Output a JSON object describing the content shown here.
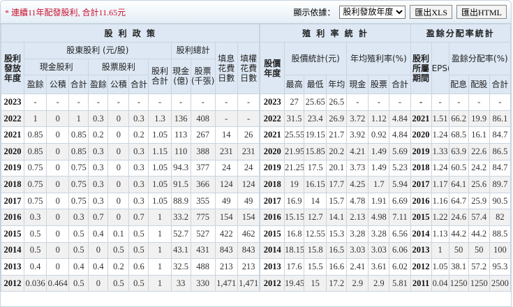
{
  "topbar": {
    "note": "* 連續11年配發股利, 合計11.65元",
    "display_label": "顯示依據：",
    "display_value": "股利發放年度",
    "export_xls": "匯出XLS",
    "export_html": "匯出HTML"
  },
  "header": {
    "policy": "股 利 政 策",
    "yield_stats": "殖 利 率 統 計",
    "payout_stats": "盈餘分配率統計",
    "dist_year": "股利發放年度",
    "shareholder_div": "股東股利 (元/股)",
    "div_total": "股利總計",
    "fill_div_days": "填息花費日數",
    "fill_right_days": "填權花費日數",
    "price_year": "股價年度",
    "price_stats": "股價統計(元)",
    "avg_yield": "年均殖利率(%)",
    "div_period": "股利所屬期間",
    "eps": "EPS(元)",
    "payout_ratio": "盈餘分配率(%)",
    "cash_div": "現金股利",
    "stock_div": "股票股利",
    "div_sum": "股利合計",
    "cash_100m": "現金(億)",
    "stock_1000": "股票(千張)",
    "earn": "盈餘",
    "reserve": "公積",
    "sum": "合計",
    "earn2": "盈餘",
    "reserve2": "公積",
    "sum2": "合計",
    "high": "最高",
    "low": "最低",
    "avg": "年均",
    "y_cash": "現金",
    "y_stock": "股票",
    "y_sum": "合計",
    "p_cash": "配息",
    "p_stock": "配股",
    "p_sum": "合計"
  },
  "rows": [
    [
      "2023",
      "-",
      "-",
      "-",
      "-",
      "-",
      "-",
      "-",
      "-",
      "-",
      "-",
      "-",
      "2023",
      "27",
      "25.65",
      "26.5",
      "-",
      "-",
      "-",
      "-",
      "-",
      "-",
      "-",
      "-"
    ],
    [
      "2022",
      "1",
      "0",
      "1",
      "0.3",
      "0",
      "0.3",
      "1.3",
      "136",
      "408",
      "-",
      "-",
      "2022",
      "31.5",
      "23.4",
      "26.9",
      "3.72",
      "1.12",
      "4.84",
      "2021",
      "1.51",
      "66.2",
      "19.9",
      "86.1"
    ],
    [
      "2021",
      "0.85",
      "0",
      "0.85",
      "0.2",
      "0",
      "0.2",
      "1.05",
      "113",
      "267",
      "14",
      "26",
      "2021",
      "25.55",
      "19.15",
      "21.7",
      "3.92",
      "0.92",
      "4.84",
      "2020",
      "1.24",
      "68.5",
      "16.1",
      "84.7"
    ],
    [
      "2020",
      "0.85",
      "0",
      "0.85",
      "0.3",
      "0",
      "0.3",
      "1.15",
      "110",
      "388",
      "231",
      "231",
      "2020",
      "21.95",
      "15.85",
      "20.2",
      "4.21",
      "1.49",
      "5.69",
      "2019",
      "1.33",
      "63.9",
      "22.6",
      "86.5"
    ],
    [
      "2019",
      "0.75",
      "0",
      "0.75",
      "0.3",
      "0",
      "0.3",
      "1.05",
      "94.3",
      "377",
      "24",
      "24",
      "2019",
      "21.25",
      "17.5",
      "20.1",
      "3.73",
      "1.49",
      "5.23",
      "2018",
      "1.24",
      "60.5",
      "24.2",
      "84.7"
    ],
    [
      "2018",
      "0.75",
      "0",
      "0.75",
      "0.3",
      "0",
      "0.3",
      "1.05",
      "91.5",
      "366",
      "124",
      "124",
      "2018",
      "19",
      "16.15",
      "17.7",
      "4.25",
      "1.7",
      "5.94",
      "2017",
      "1.17",
      "64.1",
      "25.6",
      "89.7"
    ],
    [
      "2017",
      "0.75",
      "0",
      "0.75",
      "0.3",
      "0",
      "0.3",
      "1.05",
      "88.9",
      "355",
      "49",
      "49",
      "2017",
      "16.9",
      "14",
      "15.7",
      "4.78",
      "1.91",
      "6.69",
      "2016",
      "1.16",
      "64.7",
      "25.9",
      "90.5"
    ],
    [
      "2016",
      "0.3",
      "0",
      "0.3",
      "0.7",
      "0",
      "0.7",
      "1",
      "33.2",
      "775",
      "154",
      "154",
      "2016",
      "15.15",
      "12.7",
      "14.1",
      "2.13",
      "4.98",
      "7.11",
      "2015",
      "1.22",
      "24.6",
      "57.4",
      "82"
    ],
    [
      "2015",
      "0.5",
      "0",
      "0.5",
      "0.4",
      "0.1",
      "0.5",
      "1",
      "52.7",
      "527",
      "422",
      "462",
      "2015",
      "16.8",
      "12.55",
      "15.3",
      "3.28",
      "3.28",
      "6.56",
      "2014",
      "1.13",
      "44.2",
      "44.2",
      "88.5"
    ],
    [
      "2014",
      "0.5",
      "0",
      "0.5",
      "0",
      "0.5",
      "0.5",
      "1",
      "43.1",
      "431",
      "843",
      "843",
      "2014",
      "18.15",
      "15.8",
      "16.5",
      "3.03",
      "3.03",
      "6.06",
      "2013",
      "1",
      "50",
      "50",
      "100"
    ],
    [
      "2013",
      "0.4",
      "0",
      "0.4",
      "0.4",
      "0.2",
      "0.6",
      "1",
      "32.5",
      "488",
      "213",
      "213",
      "2013",
      "17.6",
      "15.5",
      "16.6",
      "2.41",
      "3.61",
      "6.02",
      "2012",
      "1.05",
      "38.1",
      "57.2",
      "95.3"
    ],
    [
      "2012",
      "0.036",
      "0.464",
      "0.5",
      "0",
      "0.5",
      "0.5",
      "1",
      "33",
      "330",
      "1,471",
      "1,471",
      "2012",
      "19.45",
      "15",
      "17.2",
      "2.9",
      "2.9",
      "5.81",
      "2011",
      "0.04",
      "1250",
      "1250",
      "2500"
    ]
  ]
}
